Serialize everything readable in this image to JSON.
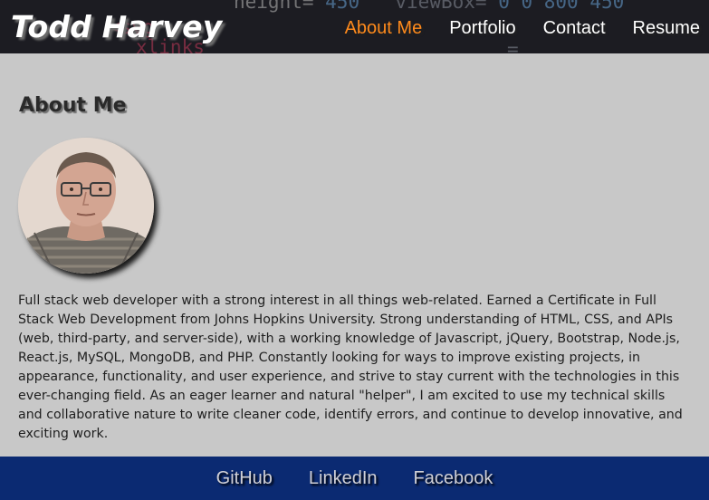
{
  "header": {
    "brand": "Todd Harvey",
    "nav": [
      {
        "label": "About Me",
        "active": true
      },
      {
        "label": "Portfolio",
        "active": false
      },
      {
        "label": "Contact",
        "active": false
      },
      {
        "label": "Resume",
        "active": false
      }
    ],
    "code_background": {
      "line1_key": "height=",
      "line1_val": "\"450\"",
      "line1_key2": "viewBox=",
      "line1_val2": "\"0 0 800 450\""
    }
  },
  "main": {
    "title": "About Me",
    "avatar_alt": "profile-photo",
    "bio": "Full stack web developer with a strong interest in all things web-related. Earned a Certificate in Full Stack Web Development from Johns Hopkins University. Strong understanding of HTML, CSS, and APIs (web, third-party, and server-side), with a working knowledge of Javascript, jQuery, Bootstrap, Node.js, React.js, MySQL, MongoDB, and PHP. Constantly looking for ways to improve existing projects, in appearance, functionality, and user experience, and strive to stay current with the technologies in this ever-changing field. As an eager learner and natural \"helper\", I am excited to use my technical skills and collaborative nature to write cleaner code, identify errors, and continue to develop innovative, and exciting work."
  },
  "footer": {
    "links": [
      "GitHub",
      "LinkedIn",
      "Facebook"
    ]
  },
  "colors": {
    "header_bg": "#1c1c22",
    "nav_active": "#ff8a1c",
    "page_bg": "#c8c8c8",
    "footer_bg": "#0b2a72"
  }
}
